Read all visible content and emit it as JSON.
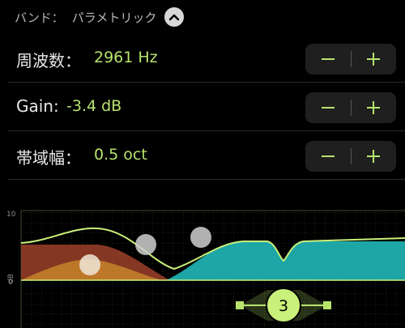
{
  "header": {
    "band_label": "バンド：",
    "band_type": "パラメトリック",
    "collapse_icon": "chevron-up-icon"
  },
  "params": [
    {
      "label": "周波数：",
      "value": "2961 Hz"
    },
    {
      "label": "Gain:",
      "value": "-3.4 dB"
    },
    {
      "label": "帯域幅：",
      "value": "0.5 oct"
    }
  ],
  "stepper": {
    "minus": "−",
    "plus": "+"
  },
  "graph": {
    "y_max_label": "10",
    "y_zero_label": "0",
    "y_unit": "dB",
    "selected_band": "3",
    "colors": {
      "accent": "#b7e36d",
      "curve": "#c9f07a",
      "band_teal": "#1ea6a6",
      "band_red": "#8c3a25",
      "band_orange": "#c07a2a",
      "grid": "#3a4a28"
    }
  }
}
